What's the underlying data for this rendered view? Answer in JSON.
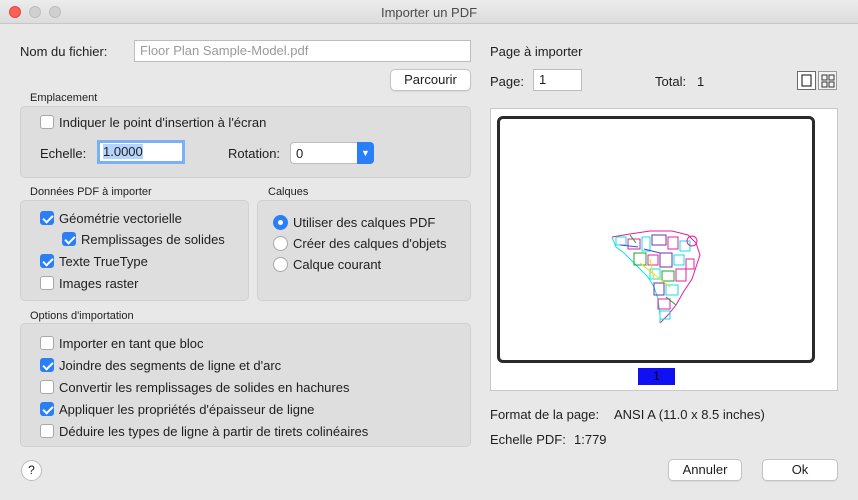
{
  "window": {
    "title": "Importer un PDF"
  },
  "file": {
    "label": "Nom du fichier:",
    "value": "Floor Plan Sample-Model.pdf",
    "browse_label": "Parcourir"
  },
  "emplacement": {
    "title": "Emplacement",
    "insertion_label": "Indiquer le point d'insertion à l'écran",
    "insertion_checked": false,
    "scale_label": "Echelle:",
    "scale_value": "1.0000",
    "rotation_label": "Rotation:",
    "rotation_value": "0"
  },
  "pdf_data": {
    "title": "Données PDF à importer",
    "items": [
      {
        "label": "Géométrie vectorielle",
        "checked": true
      },
      {
        "label": "Remplissages de solides",
        "checked": true
      },
      {
        "label": "Texte TrueType",
        "checked": true
      },
      {
        "label": "Images raster",
        "checked": false
      }
    ]
  },
  "layers": {
    "title": "Calques",
    "items": [
      {
        "label": "Utiliser des calques PDF",
        "selected": true
      },
      {
        "label": "Créer des calques d'objets",
        "selected": false
      },
      {
        "label": "Calque courant",
        "selected": false
      }
    ]
  },
  "import_options": {
    "title": "Options d'importation",
    "items": [
      {
        "label": "Importer en tant que bloc",
        "checked": false
      },
      {
        "label": "Joindre des segments de ligne et d'arc",
        "checked": true
      },
      {
        "label": "Convertir les remplissages de solides en hachures",
        "checked": false
      },
      {
        "label": "Appliquer les propriétés d'épaisseur de ligne",
        "checked": true
      },
      {
        "label": "Déduire les types de ligne à partir de tirets colinéaires",
        "checked": false
      }
    ]
  },
  "page_section": {
    "title": "Page à importer",
    "page_label": "Page:",
    "page_value": "1",
    "total_label": "Total:",
    "total_value": "1",
    "current_page_badge": "1",
    "format_label": "Format de la page:",
    "format_value": "ANSI A (11.0 x 8.5 inches)",
    "pdf_scale_label": "Echelle PDF:",
    "pdf_scale_value": "1:779"
  },
  "footer": {
    "help_label": "?",
    "cancel_label": "Annuler",
    "ok_label": "Ok"
  },
  "colors": {
    "accent": "#2b7ff6",
    "close_button": "#fe5f57",
    "page_badge": "#1010f0"
  },
  "icons": {
    "view_single": "single-page-view-icon",
    "view_grid": "grid-view-icon",
    "select_arrow": "chevron-updown-icon"
  }
}
